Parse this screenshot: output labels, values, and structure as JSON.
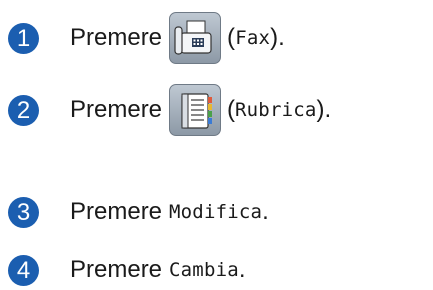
{
  "steps": [
    {
      "number": "1",
      "verb": "Premere",
      "icon": "fax-icon",
      "paren_open": "(",
      "label": "Fax",
      "paren_close": ").",
      "tail": ""
    },
    {
      "number": "2",
      "verb": "Premere",
      "icon": "address-book-icon",
      "paren_open": "(",
      "label": "Rubrica",
      "paren_close": ").",
      "tail": ""
    },
    {
      "number": "3",
      "verb": "Premere",
      "label": "Modifica",
      "tail": "."
    },
    {
      "number": "4",
      "verb": "Premere",
      "label": "Cambia",
      "tail": "."
    }
  ],
  "colors": {
    "step_number_bg": "#1b5eb0",
    "text": "#1a1a1a",
    "icon_button_bg": "#a9b3be"
  }
}
